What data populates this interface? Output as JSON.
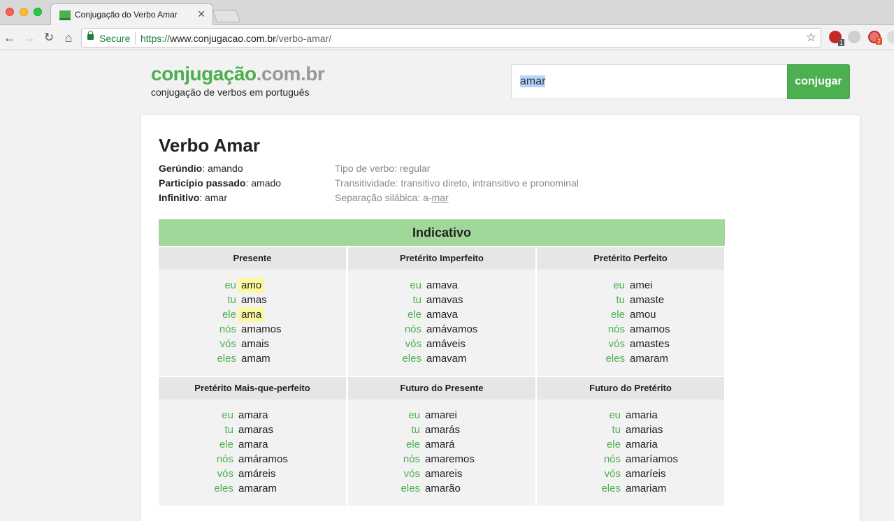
{
  "browser": {
    "tab_title": "Conjugação do Verbo Amar",
    "tab_close": "✕",
    "secure_label": "Secure",
    "url_scheme": "https://",
    "url_host": "www.conjugacao.com.br",
    "url_path": "/verbo-amar/",
    "nav": {
      "back": "←",
      "forward": "→",
      "reload": "↻",
      "home": "⌂",
      "star": "☆"
    },
    "extensions": {
      "abp_badge": "1",
      "ext2_badge": "2"
    }
  },
  "site": {
    "logo_main": "conjugação",
    "logo_domain": ".com.br",
    "tagline": "conjugação de verbos em português",
    "search_value": "amar",
    "search_button": "conjugar"
  },
  "verb": {
    "title": "Verbo Amar",
    "gerund_label": "Gerúndio",
    "gerund_value": ": amando",
    "participle_label": "Particípio passado",
    "participle_value": ": amado",
    "infinitive_label": "Infinitivo",
    "infinitive_value": ": amar",
    "type_text": "Tipo de verbo: regular",
    "transitivity_text": "Transitividade: transitivo direto, intransitivo e pronominal",
    "syllable_prefix": "Separação silábica: a-",
    "syllable_underlined": "mar"
  },
  "indicativo": {
    "title": "Indicativo",
    "tenses": [
      {
        "name": "Presente",
        "forms": [
          {
            "p": "eu",
            "v": "amo",
            "hl": true
          },
          {
            "p": "tu",
            "v": "amas"
          },
          {
            "p": "ele",
            "v": "ama",
            "hl": true
          },
          {
            "p": "nós",
            "v": "amamos"
          },
          {
            "p": "vós",
            "v": "amais"
          },
          {
            "p": "eles",
            "v": "amam"
          }
        ]
      },
      {
        "name": "Pretérito Imperfeito",
        "forms": [
          {
            "p": "eu",
            "v": "amava"
          },
          {
            "p": "tu",
            "v": "amavas"
          },
          {
            "p": "ele",
            "v": "amava"
          },
          {
            "p": "nós",
            "v": "amávamos"
          },
          {
            "p": "vós",
            "v": "amáveis"
          },
          {
            "p": "eles",
            "v": "amavam"
          }
        ]
      },
      {
        "name": "Pretérito Perfeito",
        "forms": [
          {
            "p": "eu",
            "v": "amei"
          },
          {
            "p": "tu",
            "v": "amaste"
          },
          {
            "p": "ele",
            "v": "amou"
          },
          {
            "p": "nós",
            "v": "amamos"
          },
          {
            "p": "vós",
            "v": "amastes"
          },
          {
            "p": "eles",
            "v": "amaram"
          }
        ]
      },
      {
        "name": "Pretérito Mais-que-perfeito",
        "forms": [
          {
            "p": "eu",
            "v": "amara"
          },
          {
            "p": "tu",
            "v": "amaras"
          },
          {
            "p": "ele",
            "v": "amara"
          },
          {
            "p": "nós",
            "v": "amáramos"
          },
          {
            "p": "vós",
            "v": "amáreis"
          },
          {
            "p": "eles",
            "v": "amaram"
          }
        ]
      },
      {
        "name": "Futuro do Presente",
        "forms": [
          {
            "p": "eu",
            "v": "amarei"
          },
          {
            "p": "tu",
            "v": "amarás"
          },
          {
            "p": "ele",
            "v": "amará"
          },
          {
            "p": "nós",
            "v": "amaremos"
          },
          {
            "p": "vós",
            "v": "amareis"
          },
          {
            "p": "eles",
            "v": "amarão"
          }
        ]
      },
      {
        "name": "Futuro do Pretérito",
        "forms": [
          {
            "p": "eu",
            "v": "amaria"
          },
          {
            "p": "tu",
            "v": "amarias"
          },
          {
            "p": "ele",
            "v": "amaria"
          },
          {
            "p": "nós",
            "v": "amaríamos"
          },
          {
            "p": "vós",
            "v": "amaríeis"
          },
          {
            "p": "eles",
            "v": "amariam"
          }
        ]
      }
    ]
  }
}
